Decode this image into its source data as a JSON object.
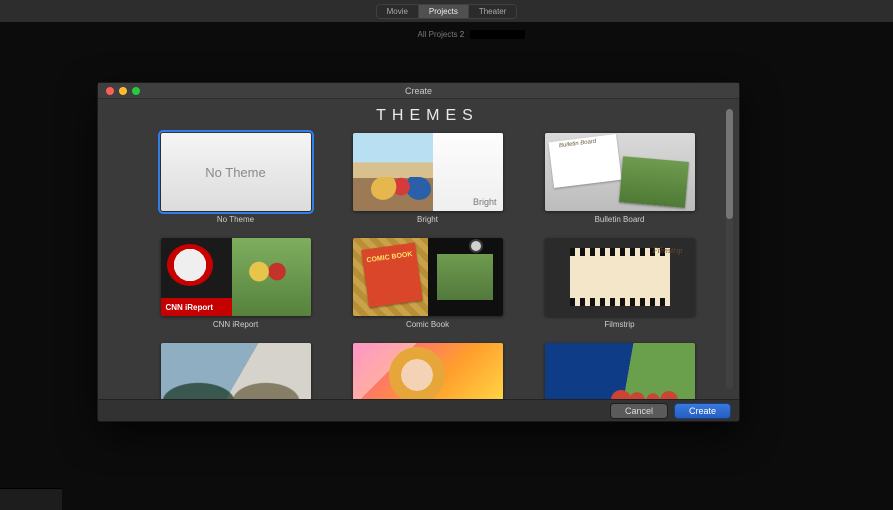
{
  "app": {
    "segments": [
      "Movie",
      "Projects",
      "Theater"
    ],
    "active_segment_index": 1,
    "breadcrumb_label": "All Projects",
    "breadcrumb_count": "2"
  },
  "sheet": {
    "title": "Create",
    "heading": "THEMES",
    "themes": [
      {
        "label": "No Theme",
        "thumb_text": "No Theme",
        "selected": true
      },
      {
        "label": "Bright",
        "badge": "Bright"
      },
      {
        "label": "Bulletin Board",
        "caption": "Bulletin Board"
      },
      {
        "label": "CNN iReport",
        "band": "CNN iReport"
      },
      {
        "label": "Comic Book",
        "book_title": "COMIC BOOK"
      },
      {
        "label": "Filmstrip",
        "caption": "Filmstrip"
      },
      {
        "label": ""
      },
      {
        "label": ""
      },
      {
        "label": ""
      }
    ],
    "buttons": {
      "cancel": "Cancel",
      "create": "Create"
    }
  }
}
